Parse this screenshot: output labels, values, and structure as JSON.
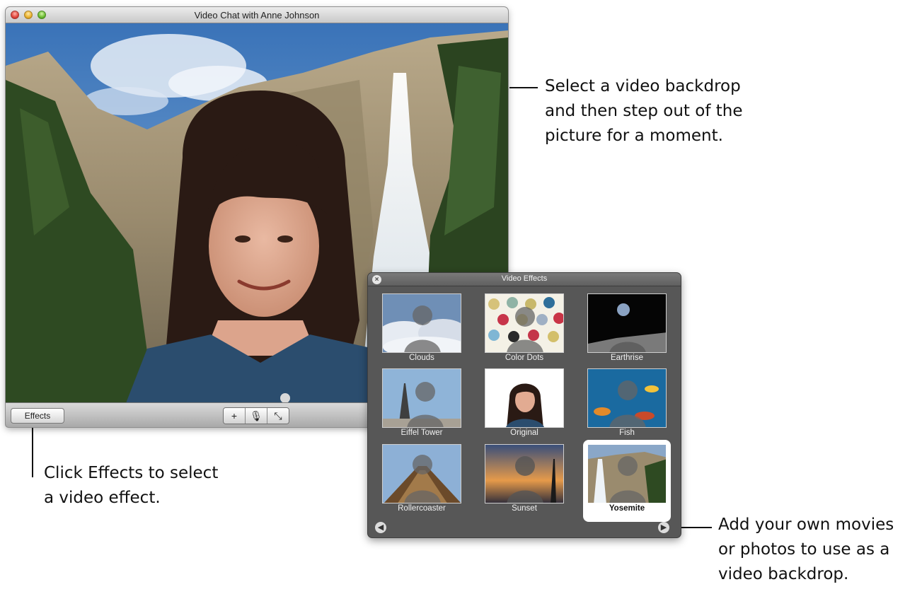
{
  "chat_window": {
    "title": "Video Chat with Anne Johnson",
    "effects_button": "Effects",
    "controls": [
      {
        "icon": "plus-icon",
        "glyph": "+"
      },
      {
        "icon": "mute-microphone-icon",
        "glyph": "🎙"
      },
      {
        "icon": "fullscreen-icon",
        "glyph": "⤡"
      }
    ]
  },
  "callouts": {
    "backdrop_tip": [
      "Select a video backdrop",
      "and then step out of the",
      "picture for a moment."
    ],
    "effects_tip": [
      "Click Effects to select",
      "a video effect."
    ],
    "custom_tip": [
      "Add your own movies",
      "or photos to use as a",
      "video backdrop."
    ]
  },
  "effects_panel": {
    "title": "Video Effects",
    "close_icon": "close-icon",
    "tiles": [
      {
        "label": "Clouds"
      },
      {
        "label": "Color Dots"
      },
      {
        "label": "Earthrise"
      },
      {
        "label": "Eiffel Tower"
      },
      {
        "label": "Original"
      },
      {
        "label": "Fish"
      },
      {
        "label": "Rollercoaster"
      },
      {
        "label": "Sunset"
      },
      {
        "label": "Yosemite",
        "selected": true
      }
    ],
    "prev_icon": "arrow-left-icon",
    "next_icon": "arrow-right-icon"
  },
  "colors": {
    "panel_bg": "#575757",
    "selected_tile": "#ffffff"
  }
}
